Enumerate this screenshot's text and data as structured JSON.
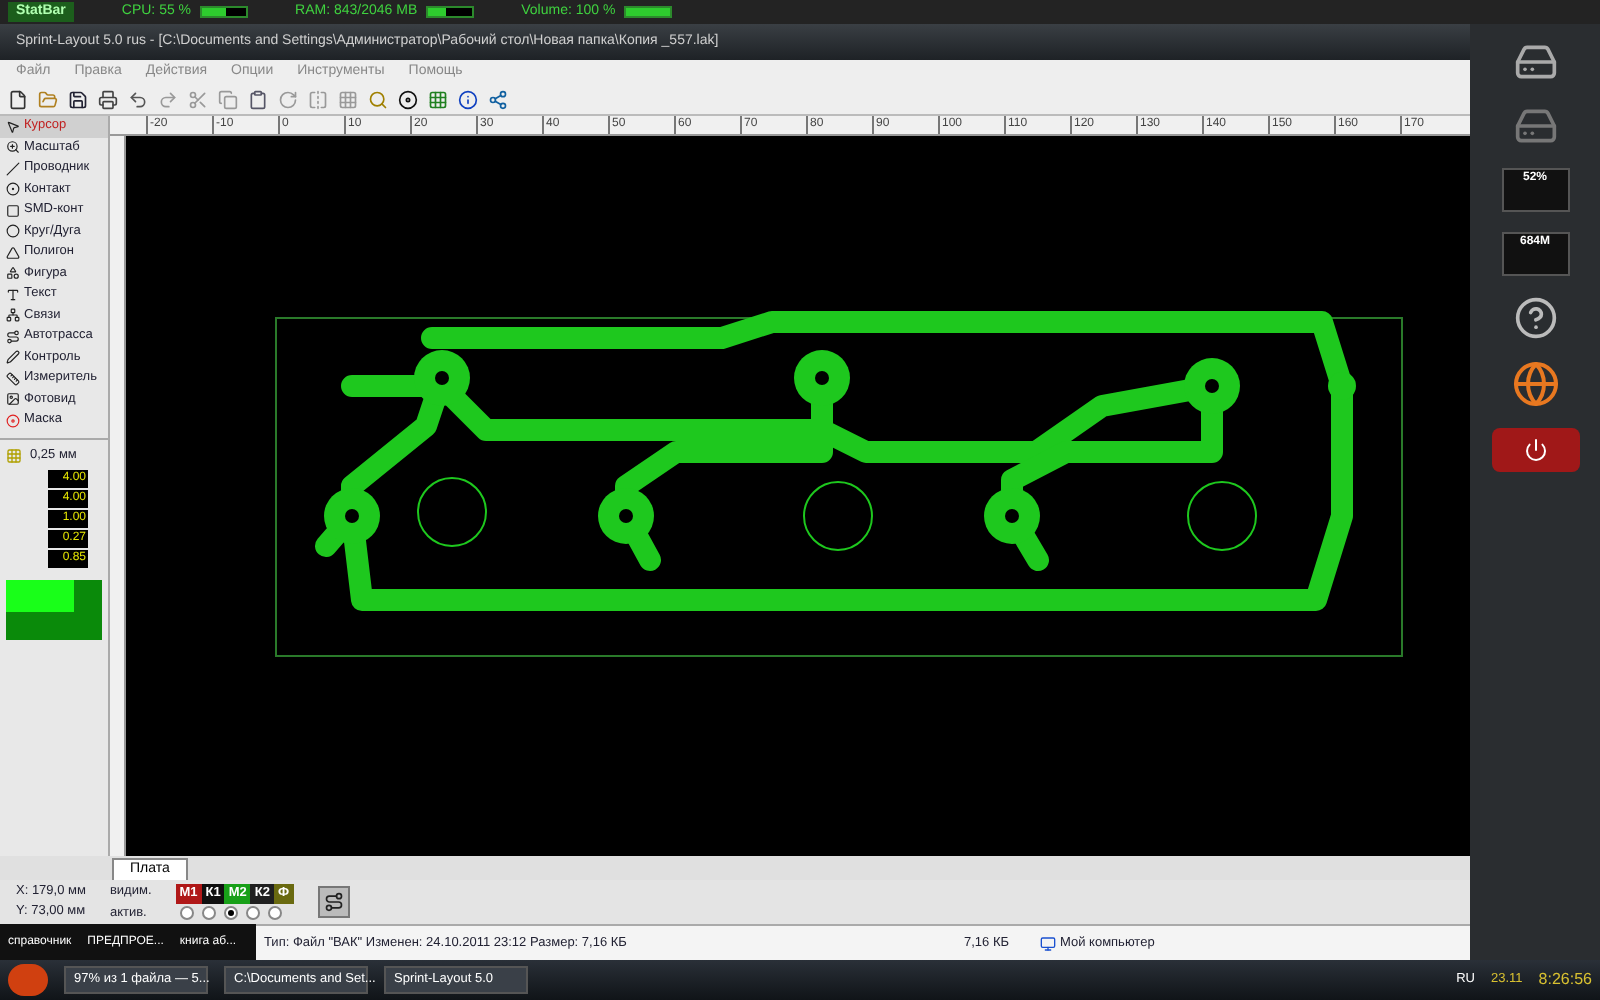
{
  "statbar": {
    "logo": "StatBar",
    "items": [
      {
        "label": "CPU: 55 %",
        "level": 0.55
      },
      {
        "label": "RAM: 843/2046 MB",
        "level": 0.41
      },
      {
        "label": "Volume: 100 %",
        "level": 1
      }
    ]
  },
  "window": {
    "title": "Sprint-Layout 5.0 rus   - [C:\\Documents and Settings\\Администратор\\Рабочий стол\\Новая папка\\Копия _557.lak]"
  },
  "menu": [
    "Файл",
    "Правка",
    "Действия",
    "Опции",
    "Инструменты",
    "Помощь"
  ],
  "ruler": {
    "labels": [
      "-20",
      "-10",
      "0",
      "10",
      "20",
      "30",
      "40",
      "50",
      "60",
      "70",
      "80",
      "90",
      "100",
      "110",
      "120",
      "130",
      "140",
      "150",
      "160",
      "170"
    ]
  },
  "tools": [
    {
      "label": "Курсор",
      "selected": true
    },
    {
      "label": "Масштаб",
      "selected": false
    },
    {
      "label": "Проводник",
      "selected": false
    },
    {
      "label": "Контакт",
      "selected": false
    },
    {
      "label": "SMD-конт",
      "selected": false
    },
    {
      "label": "Круг/Дуга",
      "selected": false
    },
    {
      "label": "Полигон",
      "selected": false
    },
    {
      "label": "Фигура",
      "selected": false
    },
    {
      "label": "Текст",
      "selected": false
    },
    {
      "label": "Связи",
      "selected": false
    },
    {
      "label": "Автотрасса",
      "selected": false
    },
    {
      "label": "Контроль",
      "selected": false
    },
    {
      "label": "Измеритель",
      "selected": false
    },
    {
      "label": "Фотовид",
      "selected": false
    },
    {
      "label": "Маска",
      "selected": false
    }
  ],
  "grid": "0,25 мм",
  "params": [
    "4.00",
    "4.00",
    "1.00",
    "0.27",
    "0.85"
  ],
  "sheet_tabs": [
    {
      "label": "Плата",
      "selected": true
    }
  ],
  "coords": [
    "X: 179,0 мм",
    "Y: 73,00 мм"
  ],
  "layers": {
    "visible_label": "видим.",
    "active_label": "актив.",
    "items": [
      {
        "label": "М1",
        "color": "#b01818",
        "active": false
      },
      {
        "label": "К1",
        "color": "#101010",
        "active": false
      },
      {
        "label": "М2",
        "color": "#18a018",
        "active": true
      },
      {
        "label": "К2",
        "color": "#202020",
        "active": false
      },
      {
        "label": "Ф",
        "color": "#6a6a10",
        "active": false
      }
    ]
  },
  "info_bar": {
    "text": "Тип: Файл \"ВАК\" Изменен: 24.10.2011 23:12 Размер: 7,16 КБ",
    "size": "7,16 КБ",
    "location": "Мой компьютер"
  },
  "desk_labels": [
    "справочник",
    "ПРЕДПРОЕ...",
    "книга аб..."
  ],
  "taskbar": {
    "tasks": [
      "97% из 1 файла — 5...",
      "C:\\Documents and Set...",
      "Sprint-Layout 5.0"
    ],
    "lang": "RU",
    "date": "23.11",
    "time": "8:26:56"
  },
  "sidebar": {
    "cpu": "52%",
    "memory": "684M"
  }
}
